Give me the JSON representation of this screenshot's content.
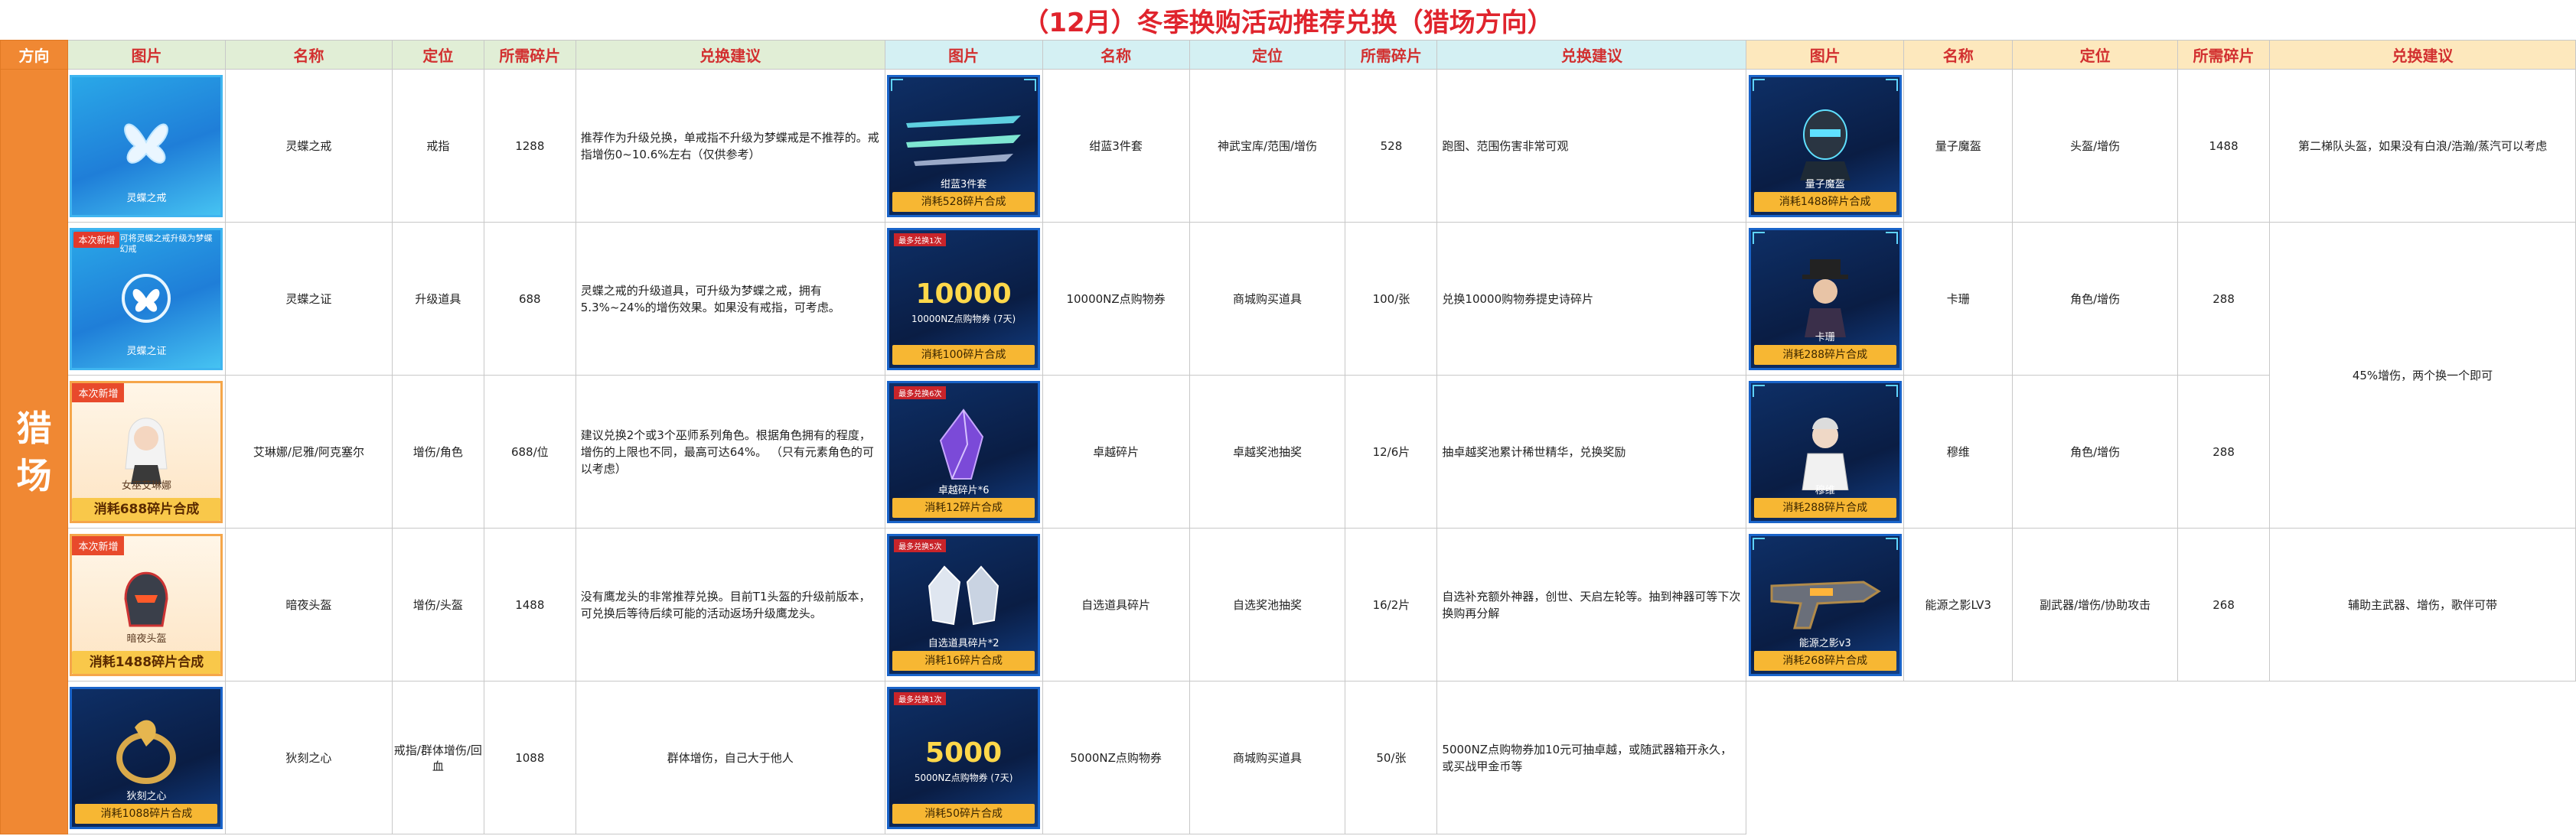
{
  "title": "（12月）冬季换购活动推荐兑换（猎场方向）",
  "header": {
    "direction": "方向",
    "columns": [
      "图片",
      "名称",
      "定位",
      "所需碎片",
      "兑换建议"
    ]
  },
  "direction_value": "猎场",
  "colors": {
    "orange": "#f08833",
    "green_header": "#e1eed6",
    "cyan_header": "#d4f0f3",
    "yellow_header": "#fde8bd",
    "title_red": "#e0242d"
  },
  "group1": [
    {
      "card_name": "灵蝶之戒",
      "card_tag": "",
      "card_note": "",
      "card_bar": "",
      "name": "灵蝶之戒",
      "role": "戒指",
      "cost": "1288",
      "advice": "推荐作为升级兑换，单戒指不升级为梦蝶戒是不推荐的。戒指增伤0~10.6%左右（仅供参考）",
      "icon": "butterfly-ring-icon"
    },
    {
      "card_name": "灵蝶之证",
      "card_tag": "本次新增",
      "card_note": "可将灵蝶之戒升级为梦蝶幻戒",
      "card_bar": "",
      "name": "灵蝶之证",
      "role": "升级道具",
      "cost": "688",
      "advice": "灵蝶之戒的升级道具，可升级为梦蝶之戒，拥有5.3%~24%的增伤效果。如果没有戒指，可考虑。",
      "icon": "butterfly-badge-icon"
    },
    {
      "card_name": "女巫艾琳娜",
      "card_tag": "本次新增",
      "card_note": "",
      "card_bar": "消耗688碎片合成",
      "name": "艾琳娜/尼雅/阿克塞尔",
      "role": "增伤/角色",
      "cost": "688/位",
      "advice": "建议兑换2个或3个巫师系列角色。根据角色拥有的程度，增伤的上限也不同，最高可达64%。 （只有元素角色的可以考虑）",
      "icon": "witch-portrait-icon"
    },
    {
      "card_name": "暗夜头盔",
      "card_tag": "本次新增",
      "card_note": "",
      "card_bar": "消耗1488碎片合成",
      "name": "暗夜头盔",
      "role": "增伤/头盔",
      "cost": "1488",
      "advice": "没有鹰龙头的非常推荐兑换。目前T1头盔的升级前版本，可兑换后等待后续可能的活动返场升级鹰龙头。",
      "icon": "dark-helmet-icon"
    },
    {
      "card_name": "狄刻之心",
      "card_tag": "",
      "card_note": "",
      "card_bar": "消耗1088碎片合成",
      "name": "狄刻之心",
      "role": "戒指/群体增伤/回血",
      "cost": "1088",
      "advice": "群体增伤，自己大于他人",
      "icon": "dike-heart-icon"
    }
  ],
  "group2": [
    {
      "card_name": "绀蓝3件套",
      "limit": "",
      "big": "",
      "sub": "",
      "card_bar": "消耗528碎片合成",
      "name": "绀蓝3件套",
      "role": "神武宝库/范围/增伤",
      "cost": "528",
      "advice": "跑图、范围伤害非常可观",
      "icon": "blue-weapon-set-icon"
    },
    {
      "card_name": "",
      "limit": "最多兑换1次",
      "big": "10000",
      "sub": "10000NZ点购物券 (7天)",
      "card_bar": "消耗100碎片合成",
      "name": "10000NZ点购物券",
      "role": "商城购买道具",
      "cost": "100/张",
      "advice": "兑换10000购物券提史诗碎片",
      "icon": "coupon-icon"
    },
    {
      "card_name": "卓越碎片*6",
      "limit": "最多兑换6次",
      "big": "",
      "sub": "",
      "card_bar": "消耗12碎片合成",
      "name": "卓越碎片",
      "role": "卓越奖池抽奖",
      "cost": "12/6片",
      "advice": "抽卓越奖池累计稀世精华，兑换奖励",
      "icon": "purple-crystal-icon"
    },
    {
      "card_name": "自选道具碎片*2",
      "limit": "最多兑换5次",
      "big": "",
      "sub": "",
      "card_bar": "消耗16碎片合成",
      "name": "自选道具碎片",
      "role": "自选奖池抽奖",
      "cost": "16/2片",
      "advice": "自选补充额外神器，创世、天启左轮等。抽到神器可等下次换购再分解",
      "icon": "silver-crystal-icon"
    },
    {
      "card_name": "",
      "limit": "最多兑换1次",
      "big": "5000",
      "sub": "5000NZ点购物券 (7天)",
      "card_bar": "消耗50碎片合成",
      "name": "5000NZ点购物券",
      "role": "商城购买道具",
      "cost": "50/张",
      "advice": "5000NZ点购物券加10元可抽卓越，或随武器箱开永久，或买战甲金币等",
      "icon": "coupon-icon"
    }
  ],
  "group3": [
    {
      "card_name": "量子魔盔",
      "card_bar": "消耗1488碎片合成",
      "name": "量子魔盔",
      "role": "头盔/增伤",
      "cost": "1488",
      "icon": "quantum-helmet-icon"
    },
    {
      "card_name": "卡珊",
      "card_bar": "消耗288碎片合成",
      "name": "卡珊",
      "role": "角色/增伤",
      "cost": "288",
      "icon": "character-hat-icon"
    },
    {
      "card_name": "穆维",
      "card_bar": "消耗288碎片合成",
      "name": "穆维",
      "role": "角色/增伤",
      "cost": "288",
      "icon": "character-white-suit-icon"
    },
    {
      "card_name": "能源之影v3",
      "card_bar": "消耗268碎片合成",
      "name": "能源之影LV3",
      "role": "副武器/增伤/协助攻击",
      "cost": "268",
      "icon": "energy-gun-icon"
    }
  ],
  "group3_advice": [
    "第二梯队头盔，如果没有白浪/浩瀚/蒸汽可以考虑",
    "45%增伤，两个换一个即可",
    "辅助主武器、增伤，歌伴可带"
  ]
}
